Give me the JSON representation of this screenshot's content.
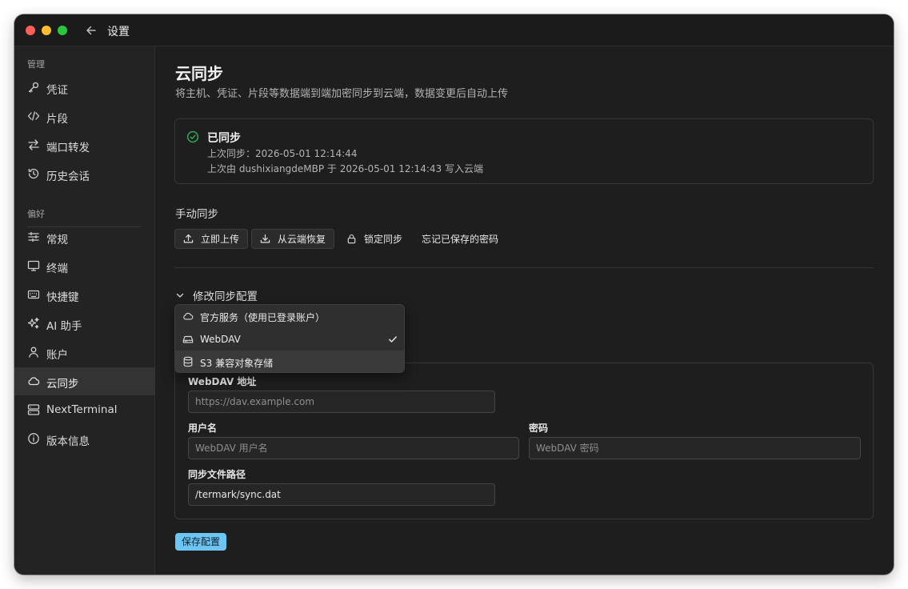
{
  "window": {
    "title": "设置"
  },
  "sidebar": {
    "sections": [
      {
        "label": "管理"
      },
      {
        "label": "偏好"
      }
    ],
    "items": [
      {
        "label": "凭证",
        "icon": "key-icon"
      },
      {
        "label": "片段",
        "icon": "code-icon"
      },
      {
        "label": "端口转发",
        "icon": "port-forward-icon"
      },
      {
        "label": "历史会话",
        "icon": "history-icon"
      },
      {
        "label": "常规",
        "icon": "sliders-icon"
      },
      {
        "label": "终端",
        "icon": "monitor-icon"
      },
      {
        "label": "快捷键",
        "icon": "keyboard-icon"
      },
      {
        "label": "AI 助手",
        "icon": "sparkles-icon"
      },
      {
        "label": "账户",
        "icon": "user-icon"
      },
      {
        "label": "云同步",
        "icon": "cloud-icon",
        "active": true
      },
      {
        "label": "NextTerminal",
        "icon": "server-icon"
      },
      {
        "label": "版本信息",
        "icon": "info-icon"
      }
    ]
  },
  "main": {
    "title": "云同步",
    "description": "将主机、凭证、片段等数据端到端加密同步到云端，数据变更后自动上传",
    "status": {
      "title": "已同步",
      "last_sync": "上次同步：2026-05-01 12:14:44",
      "last_writer": "上次由 dushixiangdeMBP 于 2026-05-01 12:14:43 写入云端",
      "icon": "check-circle-icon",
      "color": "#2fb35a"
    },
    "manual": {
      "title": "手动同步",
      "upload_label": "立即上传",
      "restore_label": "从云端恢复",
      "lock_label": "锁定同步",
      "forget_label": "忘记已保存的密码"
    },
    "config": {
      "toggle_label": "修改同步配置",
      "provider_options": [
        {
          "label": "官方服务（使用已登录账户）",
          "icon": "cloud-icon"
        },
        {
          "label": "WebDAV",
          "icon": "drive-icon",
          "selected": true
        },
        {
          "label": "S3 兼容对象存储",
          "icon": "database-icon"
        }
      ],
      "webdav_url_label": "WebDAV 地址",
      "webdav_url_placeholder": "https://dav.example.com",
      "username_label": "用户名",
      "username_placeholder": "WebDAV 用户名",
      "password_label": "密码",
      "password_placeholder": "WebDAV 密码",
      "path_label": "同步文件路径",
      "path_value": "/termark/sync.dat"
    },
    "save_label": "保存配置",
    "accent_color": "#6cc5f2"
  }
}
